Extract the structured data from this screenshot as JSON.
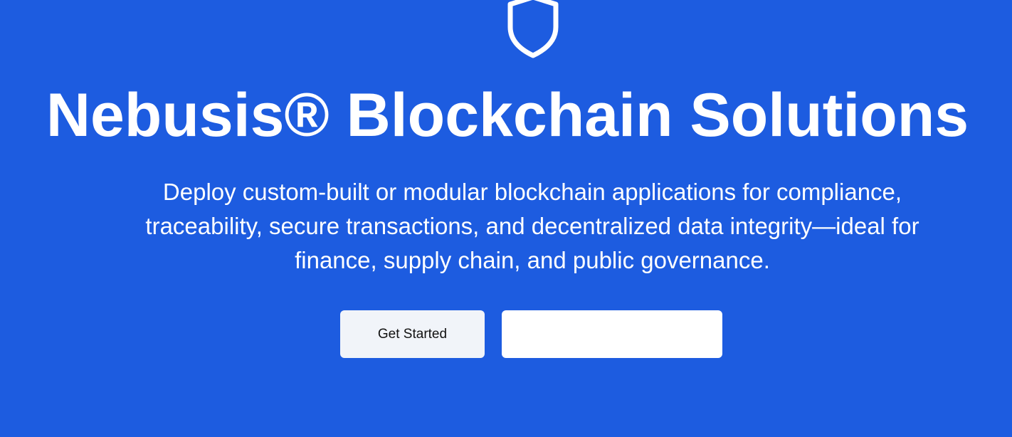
{
  "hero": {
    "icon": "shield-icon",
    "title": "Nebusis® Blockchain Solutions",
    "subtitle": "Deploy custom-built or modular blockchain applications for compliance, traceability, secure transactions, and decentralized data integrity—ideal for finance, supply chain, and public governance.",
    "primary_button_label": "Get Started",
    "secondary_button_label": ""
  },
  "colors": {
    "background": "#1d5ce0",
    "text": "#ffffff",
    "primary_button_bg": "#f1f4f9",
    "secondary_button_bg": "#ffffff"
  }
}
